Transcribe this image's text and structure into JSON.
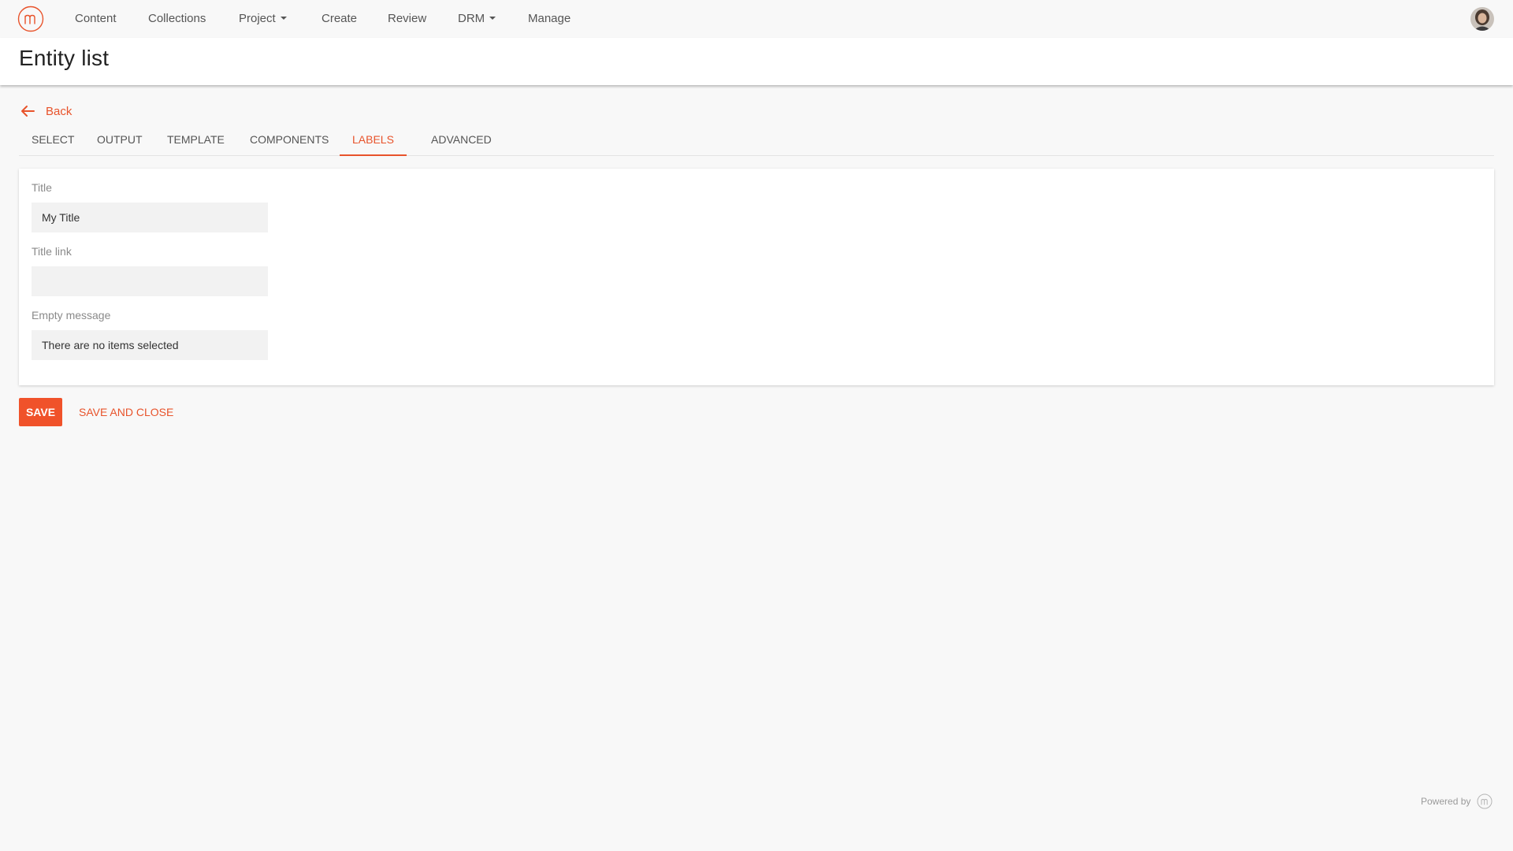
{
  "nav": {
    "items": [
      {
        "label": "Content"
      },
      {
        "label": "Collections"
      },
      {
        "label": "Project",
        "has_dropdown": true
      },
      {
        "label": "Create"
      },
      {
        "label": "Review"
      },
      {
        "label": "DRM",
        "has_dropdown": true
      },
      {
        "label": "Manage"
      }
    ],
    "logo_icon": "m-logo-icon",
    "avatar_icon": "user-avatar"
  },
  "page": {
    "title": "Entity list"
  },
  "back": {
    "label": "Back",
    "icon": "arrow-left-icon"
  },
  "tabs": [
    {
      "label": "SELECT",
      "active": false
    },
    {
      "label": "OUTPUT",
      "active": false
    },
    {
      "label": "TEMPLATE",
      "active": false
    },
    {
      "label": "COMPONENTS",
      "active": false
    },
    {
      "label": "LABELS",
      "active": true
    },
    {
      "label": "ADVANCED",
      "active": false
    }
  ],
  "form": {
    "title": {
      "label": "Title",
      "value": "My Title"
    },
    "title_link": {
      "label": "Title link",
      "value": ""
    },
    "empty_message": {
      "label": "Empty message",
      "value": "There are no items selected"
    }
  },
  "actions": {
    "save_label": "SAVE",
    "save_close_label": "SAVE AND CLOSE"
  },
  "footer": {
    "powered_by": "Powered by"
  },
  "colors": {
    "accent": "#e8532b",
    "background": "#f8f8f8",
    "card": "#ffffff",
    "input_bg": "#f2f2f2"
  }
}
